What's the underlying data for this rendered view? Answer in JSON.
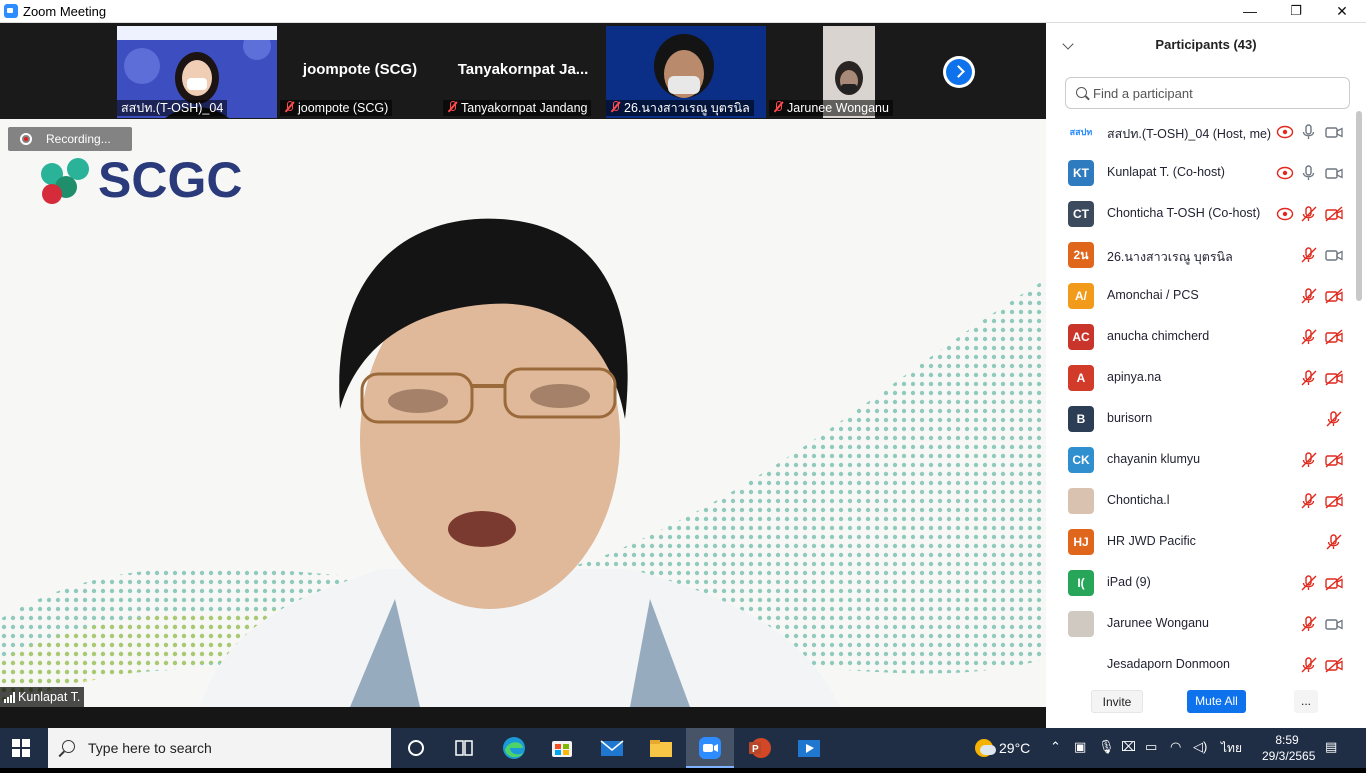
{
  "window": {
    "title": "Zoom Meeting",
    "minimize": "—",
    "restore": "❐",
    "close": "✕"
  },
  "gallery": {
    "tiles": [
      {
        "name": "สสปท.(T-OSH)_04",
        "muted": false
      },
      {
        "name": "joompote (SCG)",
        "center_name": "joompote (SCG)",
        "muted": true
      },
      {
        "name": "Tanyakornpat Jandang",
        "center_name": "Tanyakornpat  Ja...",
        "muted": true
      },
      {
        "name": "26.นางสาวเรณู บุตรนิล",
        "muted": true
      },
      {
        "name": "Jarunee Wonganu",
        "muted": true
      }
    ]
  },
  "main": {
    "recording_label": "Recording...",
    "speaker_name": "Kunlapat T.",
    "logo_text": "SCGC"
  },
  "participants": {
    "title": "Participants (43)",
    "search_placeholder": "Find a participant",
    "list": [
      {
        "initials": "สสปท",
        "name": "สสปท.(T-OSH)_04 (Host, me)",
        "color": "#ffffff",
        "rec": true,
        "mic": "on",
        "cam": "on"
      },
      {
        "initials": "KT",
        "name": "Kunlapat T. (Co-host)",
        "color": "#2e7bbf",
        "rec": true,
        "mic": "on",
        "cam": "on"
      },
      {
        "initials": "CT",
        "name": "Chonticha T-OSH (Co-host)",
        "color": "#3c4a5e",
        "rec": true,
        "mic": "off",
        "cam": "off"
      },
      {
        "initials": "2น",
        "name": "26.นางสาวเรณู บุตรนิล",
        "color": "#e0661c",
        "rec": false,
        "mic": "off",
        "cam": "on"
      },
      {
        "initials": "A/",
        "name": "Amonchai / PCS",
        "color": "#f29a1b",
        "rec": false,
        "mic": "off",
        "cam": "off"
      },
      {
        "initials": "AC",
        "name": "anucha chimcherd",
        "color": "#c9352a",
        "rec": false,
        "mic": "off",
        "cam": "off"
      },
      {
        "initials": "A",
        "name": "apinya.na",
        "color": "#d23a2a",
        "rec": false,
        "mic": "off",
        "cam": "off"
      },
      {
        "initials": "B",
        "name": "burisorn",
        "color": "#2c3e55",
        "rec": false,
        "mic": "off",
        "cam": "none"
      },
      {
        "initials": "CK",
        "name": "chayanin klumyu",
        "color": "#2f8fcf",
        "rec": false,
        "mic": "off",
        "cam": "off"
      },
      {
        "initials": "",
        "name": "Chonticha.l",
        "color": "#d9c3b0",
        "rec": false,
        "mic": "off",
        "cam": "off"
      },
      {
        "initials": "HJ",
        "name": "HR JWD Pacific",
        "color": "#e0661c",
        "rec": false,
        "mic": "off",
        "cam": "none"
      },
      {
        "initials": "I(",
        "name": "iPad (9)",
        "color": "#27a65a",
        "rec": false,
        "mic": "off",
        "cam": "off"
      },
      {
        "initials": "",
        "name": "Jarunee Wonganu",
        "color": "#cfc9c2",
        "rec": false,
        "mic": "off",
        "cam": "on"
      },
      {
        "initials": "",
        "name": "Jesadaporn Donmoon",
        "color": "#ffffff",
        "rec": false,
        "mic": "off",
        "cam": "off"
      }
    ],
    "invite_label": "Invite",
    "mute_all_label": "Mute All",
    "more_label": "..."
  },
  "taskbar": {
    "search_placeholder": "Type here to search",
    "weather": "29°C",
    "lang": "ไทย",
    "time": "8:59",
    "date": "29/3/2565"
  },
  "colors": {
    "accent": "#0e72ed",
    "muted_red": "#e0281c"
  }
}
